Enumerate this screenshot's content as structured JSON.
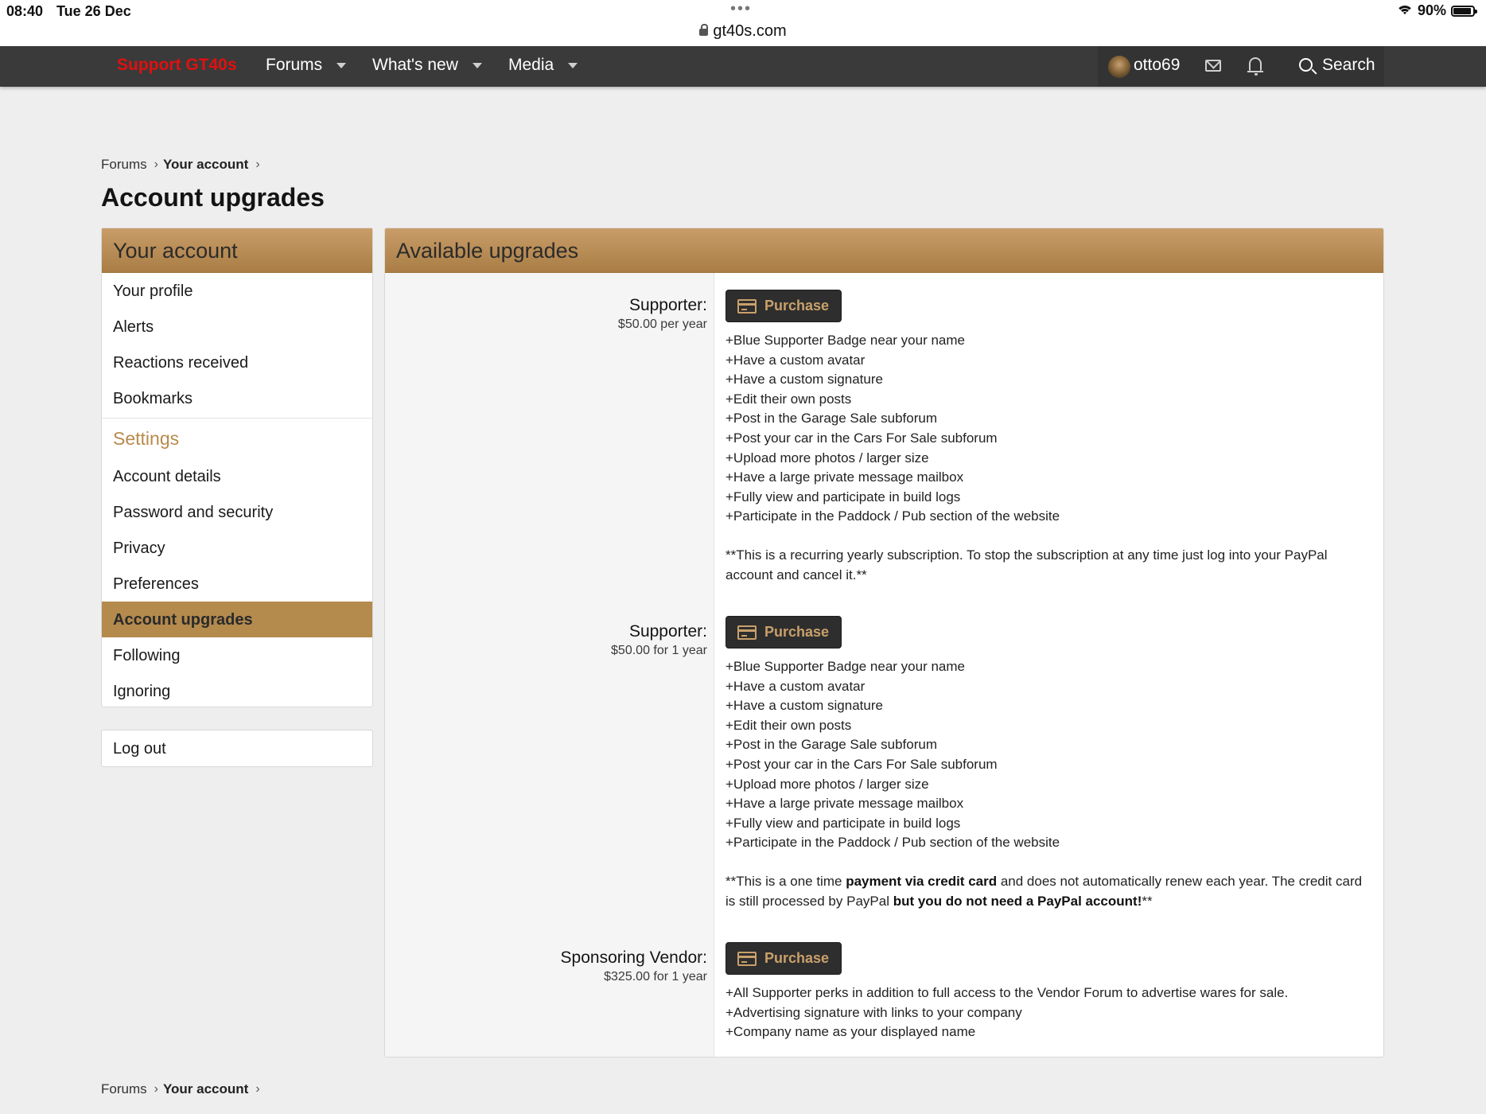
{
  "status_bar": {
    "time": "08:40",
    "date": "Tue 26 Dec",
    "url": "gt40s.com",
    "battery": "90%",
    "battery_level": 0.9
  },
  "nav": {
    "support": "Support GT40s",
    "items": [
      {
        "label": "Forums"
      },
      {
        "label": "What's new"
      },
      {
        "label": "Media"
      }
    ],
    "username": "otto69",
    "search_label": "Search"
  },
  "breadcrumb": {
    "forums": "Forums",
    "account": "Your account"
  },
  "page_title": "Account upgrades",
  "sidebar": {
    "title": "Your account",
    "items": [
      {
        "label": "Your profile"
      },
      {
        "label": "Alerts"
      },
      {
        "label": "Reactions received"
      },
      {
        "label": "Bookmarks"
      }
    ],
    "settings_heading": "Settings",
    "settings_items": [
      {
        "label": "Account details"
      },
      {
        "label": "Password and security"
      },
      {
        "label": "Privacy"
      },
      {
        "label": "Preferences"
      },
      {
        "label": "Account upgrades"
      },
      {
        "label": "Following"
      },
      {
        "label": "Ignoring"
      }
    ],
    "logout": "Log out"
  },
  "main": {
    "title": "Available upgrades",
    "purchase_label": "Purchase",
    "upgrades": [
      {
        "name": "Supporter:",
        "cost": "$50.00 per year",
        "perks": [
          "+Blue Supporter Badge near your name",
          "+Have a custom avatar",
          "+Have a custom signature",
          "+Edit their own posts",
          "+Post in the Garage Sale subforum",
          "+Post your car in the Cars For Sale subforum",
          "+Upload more photos / larger size",
          "+Have a large private message mailbox",
          "+Fully view and participate in build logs",
          "+Participate in the Paddock / Pub section of the website"
        ],
        "note": "**This is a recurring yearly subscription. To stop the subscription at any time just log into your PayPal account and cancel it.**"
      },
      {
        "name": "Supporter:",
        "cost": "$50.00 for 1 year",
        "perks": [
          "+Blue Supporter Badge near your name",
          "+Have a custom avatar",
          "+Have a custom signature",
          "+Edit their own posts",
          "+Post in the Garage Sale subforum",
          "+Post your car in the Cars For Sale subforum",
          "+Upload more photos / larger size",
          "+Have a large private message mailbox",
          "+Fully view and participate in build logs",
          "+Participate in the Paddock / Pub section of the website"
        ],
        "note_parts": {
          "a": "**This is a one time ",
          "b": "payment via credit card",
          "c": " and does not automatically renew each year. The credit card is still processed by PayPal ",
          "d": "but you do not need a PayPal account!",
          "e": "**"
        }
      },
      {
        "name": "Sponsoring Vendor:",
        "cost": "$325.00 for 1 year",
        "perks": [
          "+All Supporter perks in addition to full access to the Vendor Forum to advertise wares for sale.",
          "+Advertising signature with links to your company",
          "+Company name as your displayed name"
        ]
      }
    ]
  },
  "colors": {
    "accent": "#b48a4d",
    "nav_bg": "#3a3a3a",
    "support_red": "#e01010"
  }
}
